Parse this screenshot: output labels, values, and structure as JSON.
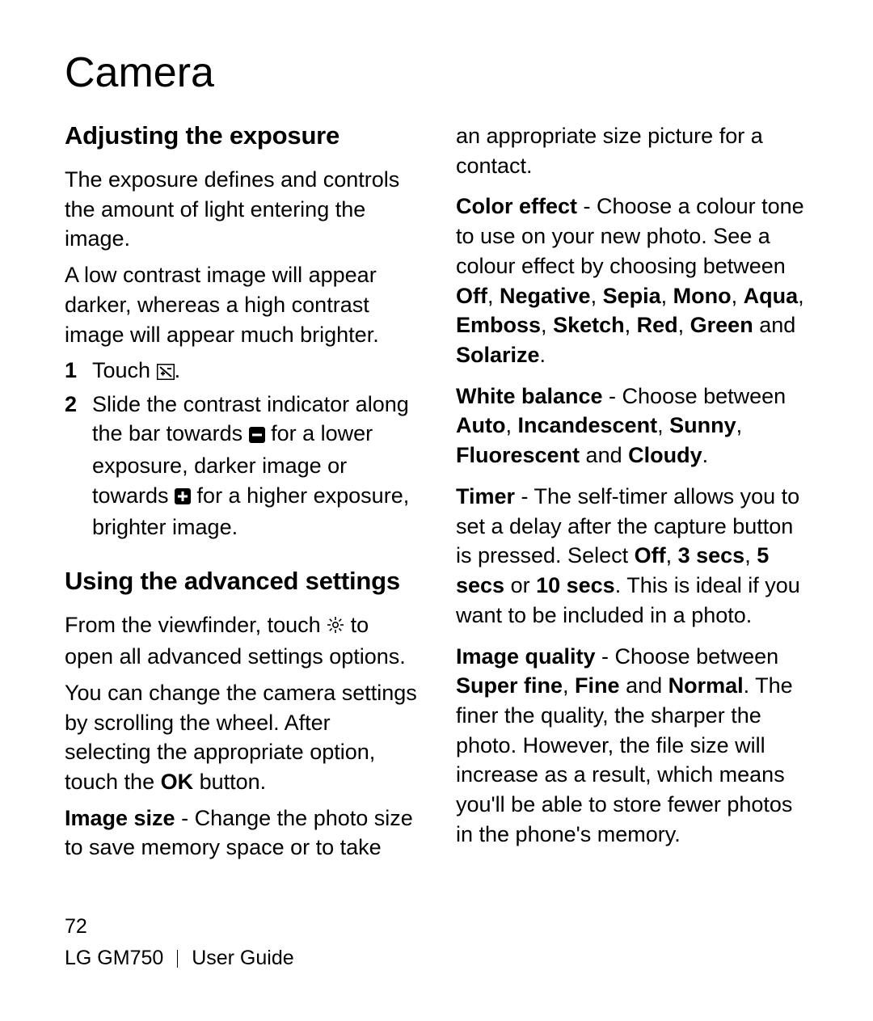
{
  "page": {
    "title": "Camera",
    "number": "72",
    "footer_left": "LG GM750",
    "footer_right": "User Guide"
  },
  "left": {
    "h_exposure": "Adjusting the exposure",
    "exp_p1": "The exposure defines and controls the amount of light entering the image.",
    "exp_p2": "A low contrast image will appear darker, whereas a high contrast image will appear much brighter.",
    "step1_a": "Touch ",
    "step1_b": ".",
    "step2_a": "Slide the contrast indicator along the bar towards ",
    "step2_b": " for a lower exposure, darker image or towards ",
    "step2_c": " for a higher exposure, brighter image.",
    "h_adv": "Using the advanced settings",
    "adv_p1_a": "From the viewfinder, touch ",
    "adv_p1_b": " to open all advanced settings options.",
    "adv_p2_a": "You can change the camera settings by scrolling the wheel. After selecting the appropriate option, touch the ",
    "adv_p2_ok": "OK",
    "adv_p2_b": " button.",
    "imgsize_label": "Image size",
    "imgsize_text": " - Change the photo size to save memory space or to take"
  },
  "right": {
    "contact_cont": "an appropriate size picture for a contact.",
    "color_label": "Color effect",
    "color_a": " - Choose a colour tone to use on your new photo. See a colour effect by choosing between ",
    "color_off": "Off",
    "color_neg": "Negative",
    "color_sepia": "Sepia",
    "color_mono": "Mono",
    "color_aqua": "Aqua",
    "color_emboss": "Emboss",
    "color_sketch": "Sketch",
    "color_red": "Red",
    "color_green": "Green",
    "color_and": " and ",
    "color_solarize": "Solarize",
    "wb_label": "White balance",
    "wb_a": " - Choose between ",
    "wb_auto": "Auto",
    "wb_incan": "Incandescent",
    "wb_sunny": "Sunny",
    "wb_fluor": "Fluorescent",
    "wb_and": " and ",
    "wb_cloudy": "Cloudy",
    "timer_label": "Timer",
    "timer_a": " - The self-timer allows you to set a delay after the capture button is pressed. Select ",
    "timer_off": "Off",
    "timer_3": "3 secs",
    "timer_5": "5 secs",
    "timer_or": " or ",
    "timer_10": "10 secs",
    "timer_b": ". This is ideal if you want to be included in a photo.",
    "iq_label": "Image quality",
    "iq_a": " - Choose between ",
    "iq_super": "Super fine",
    "iq_fine": "Fine",
    "iq_and": " and ",
    "iq_normal": "Normal",
    "iq_b": ". The finer the quality, the sharper the photo. However, the file size will increase as a result, which means you'll be able to store fewer photos in the phone's memory.",
    "comma": ", ",
    "period": "."
  }
}
